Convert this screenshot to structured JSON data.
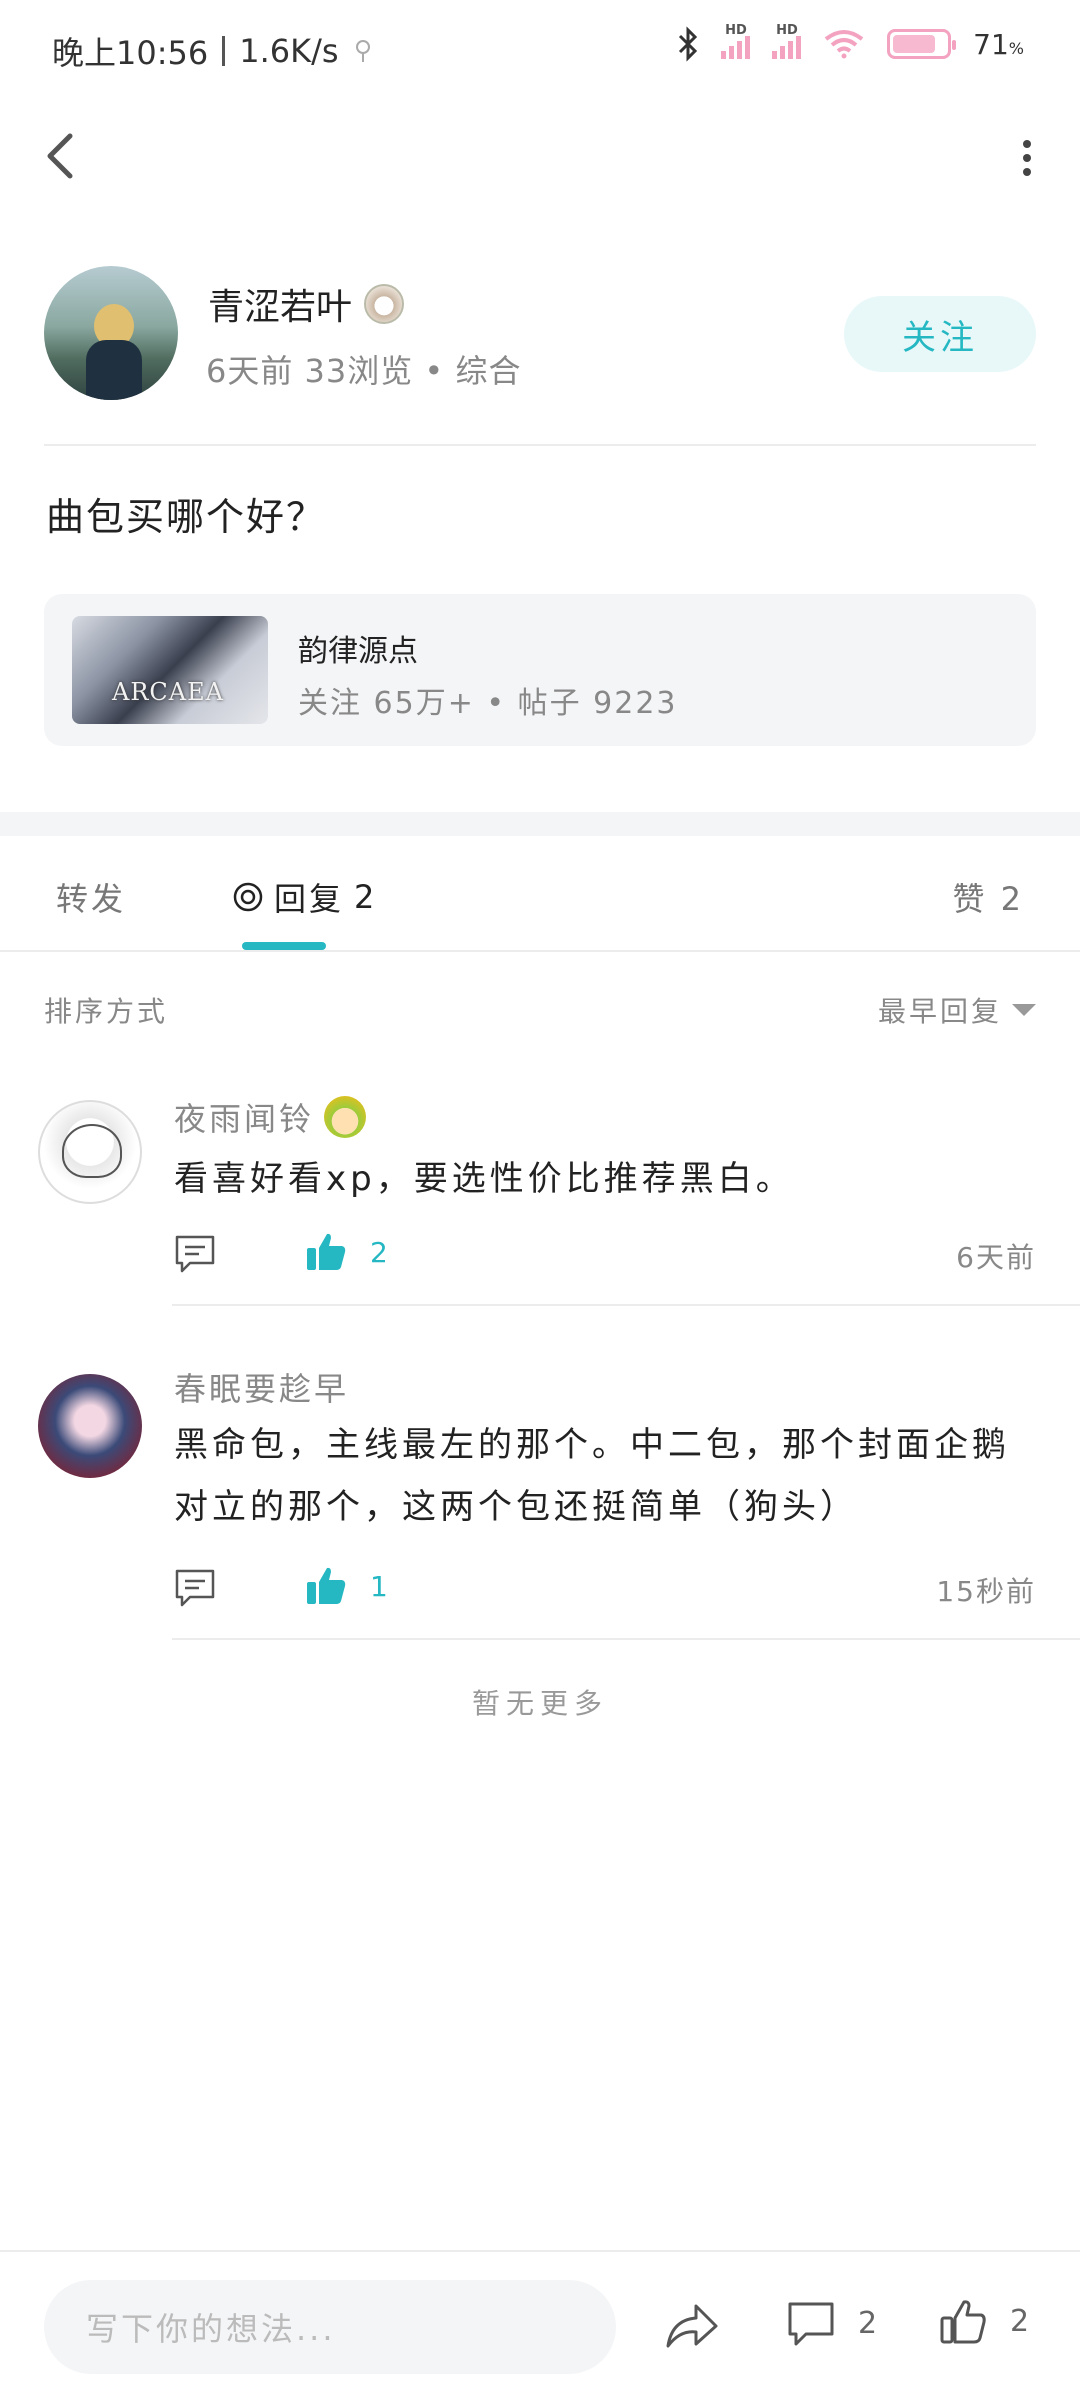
{
  "status_bar": {
    "time": "晚上10:56",
    "speed": "1.6K/s",
    "battery": "71"
  },
  "author": {
    "name": "青涩若叶",
    "meta": "6天前  33浏览 • 综合",
    "follow_label": "关注"
  },
  "post": {
    "text": "曲包买哪个好？"
  },
  "topic": {
    "thumb_text": "ARCAEA",
    "name": "韵律源点",
    "stats": "关注 65万+ • 帖子 9223"
  },
  "tabs": {
    "forward": "转发",
    "reply": "回复",
    "reply_count": "2",
    "like": "赞 2"
  },
  "sort": {
    "label": "排序方式",
    "selected": "最早回复"
  },
  "comments": [
    {
      "name": "夜雨闻铃",
      "text": "看喜好看xp，要选性价比推荐黑白。",
      "likes": "2",
      "time": "6天前"
    },
    {
      "name": "春眠要趁早",
      "text": "黑命包，主线最左的那个。中二包，那个封面企鹅对立的那个，这两个包还挺简单（狗头）",
      "likes": "1",
      "time": "15秒前"
    }
  ],
  "no_more": "暂无更多",
  "bottom_bar": {
    "input_placeholder": "写下你的想法...",
    "comment_count": "2",
    "like_count": "2"
  },
  "colors": {
    "accent": "#25b8c3",
    "follow_bg": "#e8f8f9",
    "card_bg": "#f4f5f7"
  }
}
